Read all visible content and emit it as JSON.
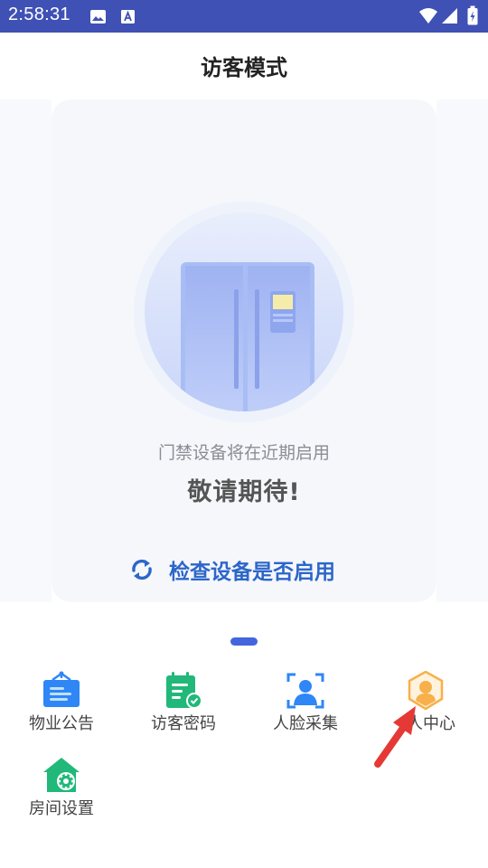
{
  "status_bar": {
    "time": "2:58:31",
    "notification_icons": [
      "image-icon",
      "font-icon"
    ],
    "system_icons": [
      "wifi-icon",
      "signal-icon",
      "battery-icon"
    ],
    "background_color": "#3f51b5"
  },
  "header": {
    "title": "访客模式"
  },
  "card": {
    "notice_line1": "门禁设备将在近期启用",
    "notice_line2": "敬请期待!",
    "check_button_label": "检查设备是否启用",
    "illustration": "door-access-device-illustration"
  },
  "page_indicator": {
    "active_index": 0
  },
  "menu": {
    "items": [
      {
        "label": "物业公告",
        "icon": "announcement-icon",
        "color": "#2f86f6"
      },
      {
        "label": "访客密码",
        "icon": "visitor-password-icon",
        "color": "#21b87a"
      },
      {
        "label": "人脸采集",
        "icon": "face-capture-icon",
        "color": "#2f86f6"
      },
      {
        "label": "人中心",
        "icon": "personal-center-icon",
        "color": "#f7b04a"
      },
      {
        "label": "房间设置",
        "icon": "room-settings-icon",
        "color": "#21b87a"
      }
    ]
  },
  "annotation": {
    "color": "#e53935"
  }
}
